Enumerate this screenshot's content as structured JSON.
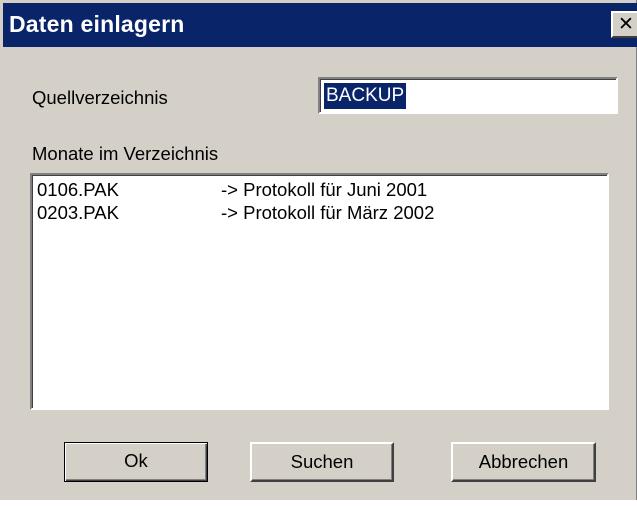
{
  "window": {
    "title": "Daten einlagern",
    "close_symbol": "✕",
    "close_icon": "close-icon"
  },
  "source": {
    "label": "Quellverzeichnis",
    "value": "BACKUP"
  },
  "months": {
    "label": "Monate im Verzeichnis",
    "items": [
      {
        "file": "0106.PAK",
        "desc": "->  Protokoll für Juni 2001"
      },
      {
        "file": "0203.PAK",
        "desc": "->  Protokoll für März 2002"
      }
    ]
  },
  "buttons": {
    "ok": "Ok",
    "search": "Suchen",
    "cancel": "Abbrechen"
  },
  "colors": {
    "titlebar": "#0a246a",
    "face": "#d4d0c8",
    "selection": "#0a246a"
  }
}
